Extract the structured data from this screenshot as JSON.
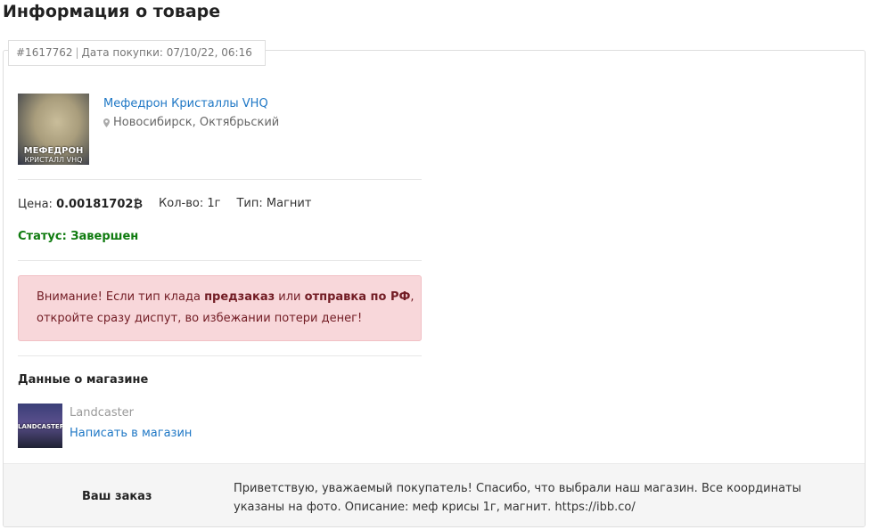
{
  "page": {
    "title": "Информация о товаре"
  },
  "order": {
    "id": "#1617762",
    "purchase_date_label": "Дата покупки:",
    "purchase_date": "07/10/22, 06:16"
  },
  "product": {
    "name": "Мефедрон Кристаллы VHQ",
    "location": "Новосибирск, Октябрьский",
    "thumb_caption_main": "МЕФЕДРОН",
    "thumb_caption_sub": "КРИСТАЛЛ VHQ",
    "price_label": "Цена:",
    "price_value": "0.00181702₿",
    "qty_label": "Кол-во:",
    "qty_value": "1г",
    "type_label": "Тип:",
    "type_value": "Магнит",
    "status_label": "Статус:",
    "status_value": "Завершен",
    "status_color": "#0f7b0f"
  },
  "alert": {
    "part1": "Внимание! Если тип клада ",
    "bold1": "предзаказ",
    "part2": " или ",
    "bold2": "отправка по РФ",
    "part3": ",",
    "line2": "откройте сразу диспут, во избежании потери денег!"
  },
  "shop": {
    "heading": "Данные о магазине",
    "name": "Landcaster",
    "logo_text": "LANDCASTER",
    "message_link": "Написать в магазин"
  },
  "order_note": {
    "label": "Ваш заказ",
    "text": "Приветствую, уважаемый покупатель! Спасибо, что выбрали наш магазин. Все координаты указаны на фото. Описание: меф крисы 1г, магнит. https://ibb.co/"
  },
  "icons": {
    "location": "map-pin-icon"
  },
  "colors": {
    "link": "#1e77c5",
    "alert_bg": "#f8d7da",
    "alert_text": "#721c24"
  }
}
